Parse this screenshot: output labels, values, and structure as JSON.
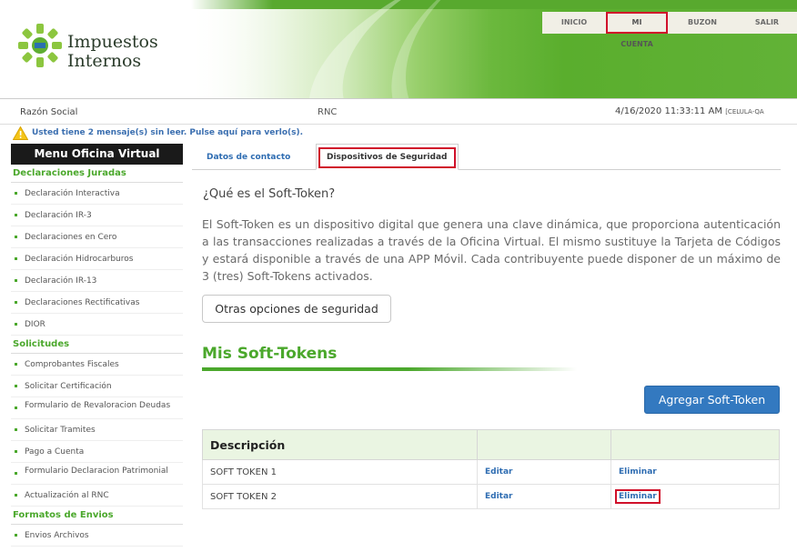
{
  "header": {
    "logo_line1": "Impuestos",
    "logo_line2": "Internos",
    "nav": [
      {
        "label": "INICIO",
        "highlighted": false
      },
      {
        "label": "MI CUENTA",
        "highlighted": true
      },
      {
        "label": "BUZON",
        "highlighted": false
      },
      {
        "label": "SALIR",
        "highlighted": false
      }
    ]
  },
  "info": {
    "razon_social_label": "Razón Social",
    "rnc_label": "RNC",
    "datetime": "4/16/2020 11:33:11 AM",
    "celula": "[CELULA-QA"
  },
  "message": "Usted tiene 2 mensaje(s) sin leer. Pulse aquí para verlo(s).",
  "sidebar": {
    "title": "Menu Oficina Virtual",
    "sections": [
      {
        "title": "Declaraciones Juradas",
        "items": [
          "Declaración Interactiva",
          "Declaración IR-3",
          "Declaraciones en Cero",
          "Declaración Hidrocarburos",
          "Declaración IR-13",
          "Declaraciones Rectificativas",
          "DIOR"
        ]
      },
      {
        "title": "Solicitudes",
        "items": [
          "Comprobantes Fiscales",
          "Solicitar Certificación",
          "Formulario de Revaloracion Deudas",
          "Solicitar Tramites",
          "Pago a Cuenta",
          "Formulario Declaracion Patrimonial",
          "Actualización al RNC"
        ]
      },
      {
        "title": "Formatos de Envios",
        "items": [
          "Envios Archivos"
        ]
      }
    ]
  },
  "tabs": [
    {
      "label": "Datos de contacto",
      "active": false
    },
    {
      "label": "Dispositivos de Seguridad",
      "active": true
    }
  ],
  "content": {
    "question_title": "¿Qué es el Soft-Token?",
    "description": "El Soft-Token es un dispositivo digital que genera una clave dinámica, que proporciona autenticación a las transacciones realizadas a través de la Oficina Virtual. El mismo sustituye la Tarjeta de Códigos y estará disponible a través de una APP Móvil. Cada contribuyente puede disponer de un máximo de 3 (tres) Soft-Tokens activados.",
    "otras_button": "Otras opciones de seguridad",
    "mis_title": "Mis Soft-Tokens",
    "agregar_button": "Agregar Soft-Token",
    "table": {
      "header": "Descripción",
      "rows": [
        {
          "descripcion": "SOFT TOKEN 1",
          "editar": "Editar",
          "eliminar": "Eliminar"
        },
        {
          "descripcion": "SOFT TOKEN 2",
          "editar": "Editar",
          "eliminar": "Eliminar"
        }
      ]
    }
  },
  "colors": {
    "brand_green": "#4ba82c",
    "link_blue": "#2f6db2",
    "highlight_red": "#d0102a",
    "primary_button": "#3379c0"
  }
}
